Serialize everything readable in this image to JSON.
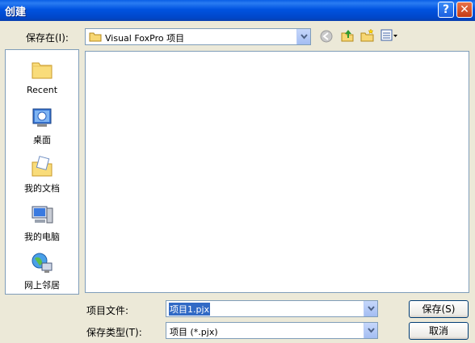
{
  "dialog": {
    "title": "创建"
  },
  "titlebar": {
    "help_glyph": "?",
    "close_glyph": "✕"
  },
  "savein": {
    "label": "保存在(I):",
    "value": "Visual FoxPro 项目"
  },
  "places": [
    {
      "label": "Recent",
      "icon": "recent-folder-icon"
    },
    {
      "label": "桌面",
      "icon": "desktop-icon"
    },
    {
      "label": "我的文档",
      "icon": "my-documents-icon"
    },
    {
      "label": "我的电脑",
      "icon": "my-computer-icon"
    },
    {
      "label": "网上邻居",
      "icon": "network-places-icon"
    }
  ],
  "filename": {
    "label": "项目文件:",
    "value": "项目1.pjx"
  },
  "filetype": {
    "label": "保存类型(T):",
    "value": "项目 (*.pjx)"
  },
  "buttons": {
    "save": "保存(S)",
    "cancel": "取消"
  },
  "colors": {
    "titlebar": "#0054e3",
    "face": "#ece9d8",
    "selection": "#316ac5"
  }
}
